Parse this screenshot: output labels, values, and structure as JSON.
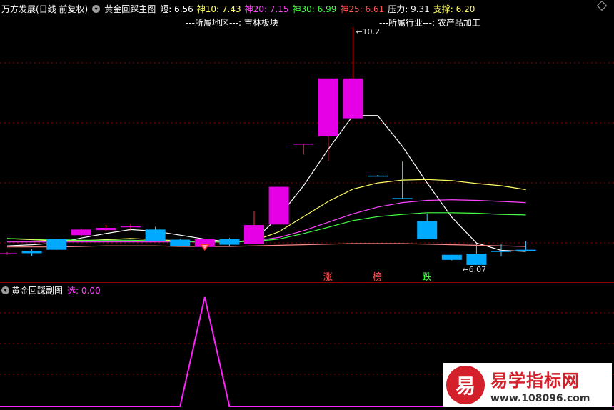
{
  "header": {
    "stock_name": "万方发展(日线 前复权)",
    "indicator_name": "黄金回踩主图",
    "items": [
      {
        "label": "短: 6.56",
        "color": "#ffffff"
      },
      {
        "label": "神10: 7.43",
        "color": "#ffff66"
      },
      {
        "label": "神20: 7.15",
        "color": "#ff44ff"
      },
      {
        "label": "神30: 6.99",
        "color": "#44ff44"
      },
      {
        "label": "神25: 6.61",
        "color": "#ff5555"
      },
      {
        "label": "压力: 9.31",
        "color": "#ffffff"
      },
      {
        "label": "支撑: 6.20",
        "color": "#ffff66"
      }
    ]
  },
  "region_label": "---所属地区---: 吉林板块",
  "industry_label": "---所属行业---: 农产品加工",
  "annotations": {
    "high_label": "10.2",
    "low_label": "6.07",
    "zhang": "涨",
    "bang": "榜",
    "die": "跌"
  },
  "sub_header": {
    "indicator_name": "黄金回踩副图",
    "value_label": "选: 0.00"
  },
  "watermark": {
    "logo_char": "易",
    "title": "易学指标网",
    "url": "www.108096.com"
  },
  "colors": {
    "up": "#e600e6",
    "down": "#00aaff",
    "short_line": "#ffffff",
    "ma10": "#ffff66",
    "ma20": "#ff44ff",
    "ma30": "#44ff44",
    "ma25": "#ff8888",
    "sub_line": "#ff22ff"
  },
  "chart_data": {
    "type": "candlestick",
    "candles": [
      {
        "o": 6.18,
        "c": 6.2,
        "h": 6.22,
        "l": 6.17
      },
      {
        "o": 6.24,
        "c": 6.2,
        "h": 6.27,
        "l": 6.15
      },
      {
        "o": 6.45,
        "c": 6.26,
        "h": 6.45,
        "l": 6.26
      },
      {
        "o": 6.52,
        "c": 6.62,
        "h": 6.64,
        "l": 6.5
      },
      {
        "o": 6.61,
        "c": 6.65,
        "h": 6.7,
        "l": 6.6
      },
      {
        "o": 6.66,
        "c": 6.68,
        "h": 6.72,
        "l": 6.6
      },
      {
        "o": 6.62,
        "c": 6.42,
        "h": 6.67,
        "l": 6.42
      },
      {
        "o": 6.44,
        "c": 6.32,
        "h": 6.46,
        "l": 6.32
      },
      {
        "o": 6.31,
        "c": 6.45,
        "h": 6.45,
        "l": 6.31
      },
      {
        "o": 6.45,
        "c": 6.35,
        "h": 6.47,
        "l": 6.33
      },
      {
        "o": 6.36,
        "c": 6.7,
        "h": 6.94,
        "l": 6.36
      },
      {
        "o": 6.71,
        "c": 7.38,
        "h": 7.38,
        "l": 6.71
      },
      {
        "o": 8.15,
        "c": 8.15,
        "h": 8.15,
        "l": 7.95
      },
      {
        "o": 8.28,
        "c": 9.31,
        "h": 9.31,
        "l": 7.84
      },
      {
        "o": 8.6,
        "c": 9.31,
        "h": 10.22,
        "l": 8.6
      },
      {
        "o": 7.58,
        "c": 7.57,
        "h": 7.59,
        "l": 7.56
      },
      {
        "o": 7.18,
        "c": 7.16,
        "h": 7.83,
        "l": 7.16
      },
      {
        "o": 6.77,
        "c": 6.45,
        "h": 6.9,
        "l": 6.45
      },
      {
        "o": 6.17,
        "c": 6.08,
        "h": 6.17,
        "l": 6.07
      },
      {
        "o": 6.19,
        "c": 5.99,
        "h": 6.36,
        "l": 5.99
      },
      {
        "o": 6.24,
        "c": 6.23,
        "h": 6.36,
        "l": 6.14
      },
      {
        "o": 6.26,
        "c": 6.25,
        "h": 6.41,
        "l": 6.24
      }
    ],
    "ma_lines": [
      {
        "name": "短",
        "color": "#ffffff",
        "values": [
          6.33,
          6.35,
          6.38,
          6.47,
          6.55,
          6.62,
          6.59,
          6.52,
          6.45,
          6.4,
          6.43,
          6.85,
          7.4,
          8.05,
          8.65,
          8.65,
          8.1,
          7.45,
          6.84,
          6.38,
          6.25,
          6.23
        ]
      },
      {
        "name": "神10",
        "color": "#ffff66",
        "values": [
          6.46,
          6.44,
          6.42,
          6.42,
          6.44,
          6.46,
          6.44,
          6.42,
          6.4,
          6.4,
          6.42,
          6.58,
          6.85,
          7.12,
          7.34,
          7.45,
          7.5,
          7.51,
          7.49,
          7.44,
          7.4,
          7.33
        ]
      },
      {
        "name": "神20",
        "color": "#ff44ff",
        "values": [
          6.4,
          6.4,
          6.4,
          6.4,
          6.4,
          6.4,
          6.4,
          6.4,
          6.4,
          6.4,
          6.42,
          6.48,
          6.6,
          6.75,
          6.9,
          7.02,
          7.1,
          7.14,
          7.15,
          7.14,
          7.12,
          7.1
        ]
      },
      {
        "name": "神30",
        "color": "#44ff44",
        "values": [
          6.46,
          6.45,
          6.44,
          6.43,
          6.43,
          6.43,
          6.42,
          6.41,
          6.4,
          6.4,
          6.41,
          6.45,
          6.55,
          6.66,
          6.78,
          6.85,
          6.89,
          6.92,
          6.92,
          6.91,
          6.89,
          6.88
        ]
      },
      {
        "name": "神25",
        "color": "#ff8888",
        "values": [
          6.31,
          6.31,
          6.31,
          6.32,
          6.33,
          6.33,
          6.33,
          6.32,
          6.32,
          6.32,
          6.33,
          6.34,
          6.35,
          6.36,
          6.37,
          6.37,
          6.37,
          6.36,
          6.35,
          6.34,
          6.33,
          6.32
        ]
      }
    ],
    "ylim": [
      5.9,
      10.4
    ],
    "sub_series": {
      "name": "选",
      "values": [
        0,
        0,
        0,
        0,
        0,
        0,
        0,
        0,
        1,
        0,
        0,
        0,
        0,
        0,
        0,
        0,
        0,
        0,
        0,
        0,
        0,
        0
      ]
    }
  }
}
